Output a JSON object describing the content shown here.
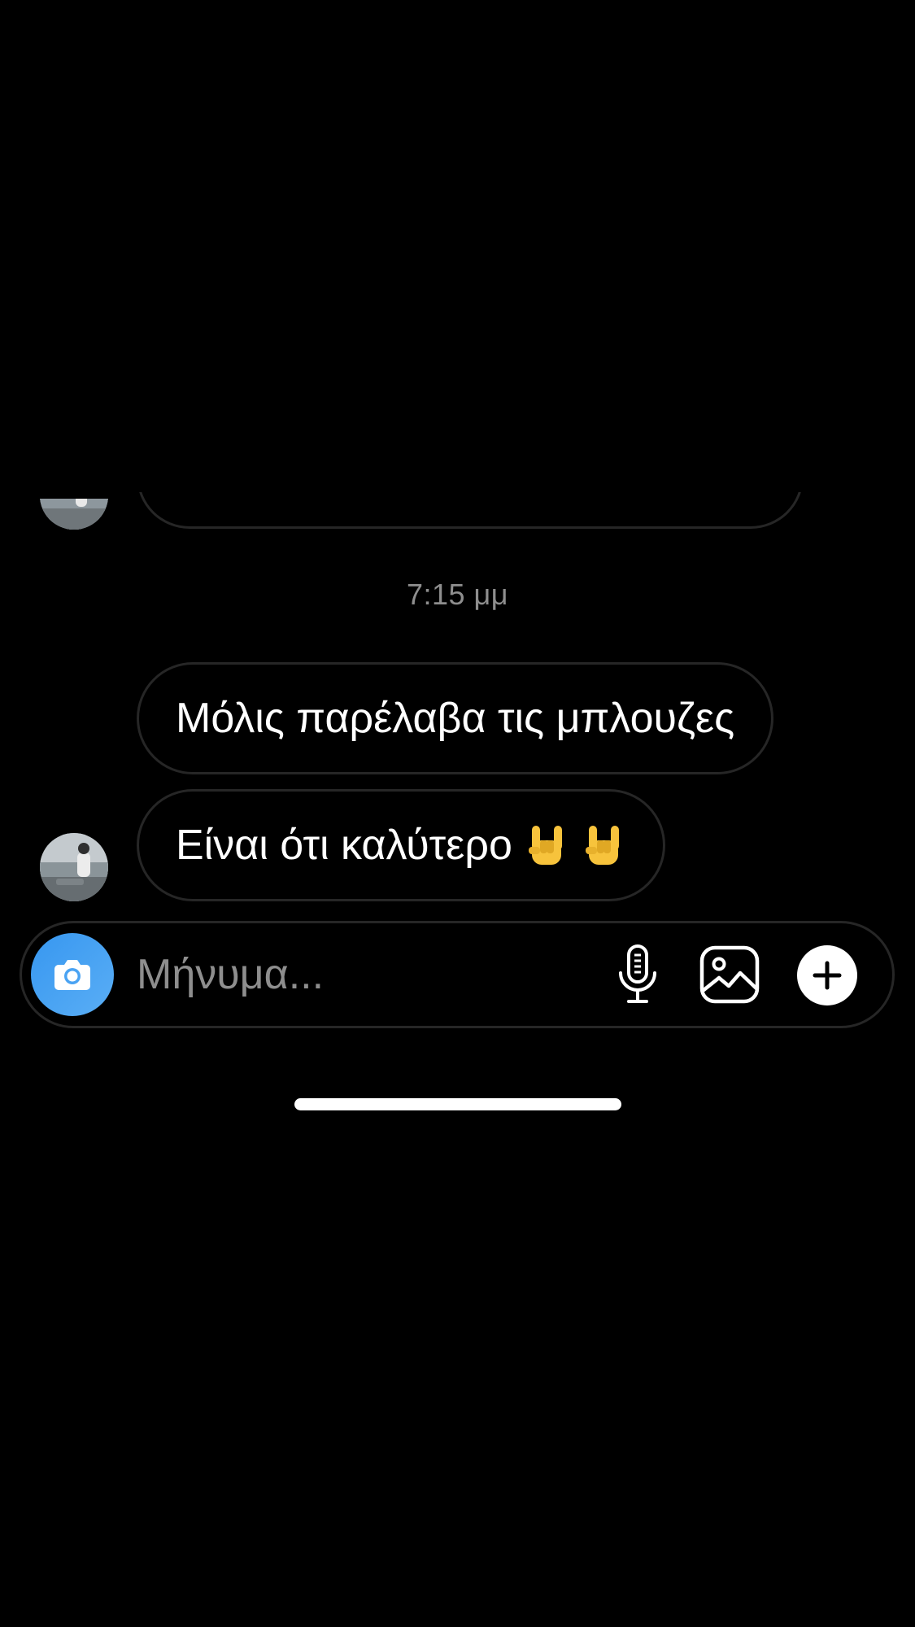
{
  "thread": {
    "timestamp": "7:15 μμ",
    "messages": [
      {
        "text": "Μόλις παρέλαβα τις μπλουζες"
      },
      {
        "text": "Είναι ότι καλύτερο"
      }
    ],
    "emoji": [
      "sign-of-the-horns",
      "sign-of-the-horns"
    ]
  },
  "composer": {
    "placeholder": "Μήνυμα..."
  },
  "icons": {
    "camera": "camera-icon",
    "mic": "microphone-icon",
    "gallery": "gallery-icon",
    "plus": "plus-icon"
  },
  "colors": {
    "background": "#000000",
    "bubble_border": "#262626",
    "camera_button": "#3797f0",
    "secondary_text": "#8e8e8e"
  }
}
